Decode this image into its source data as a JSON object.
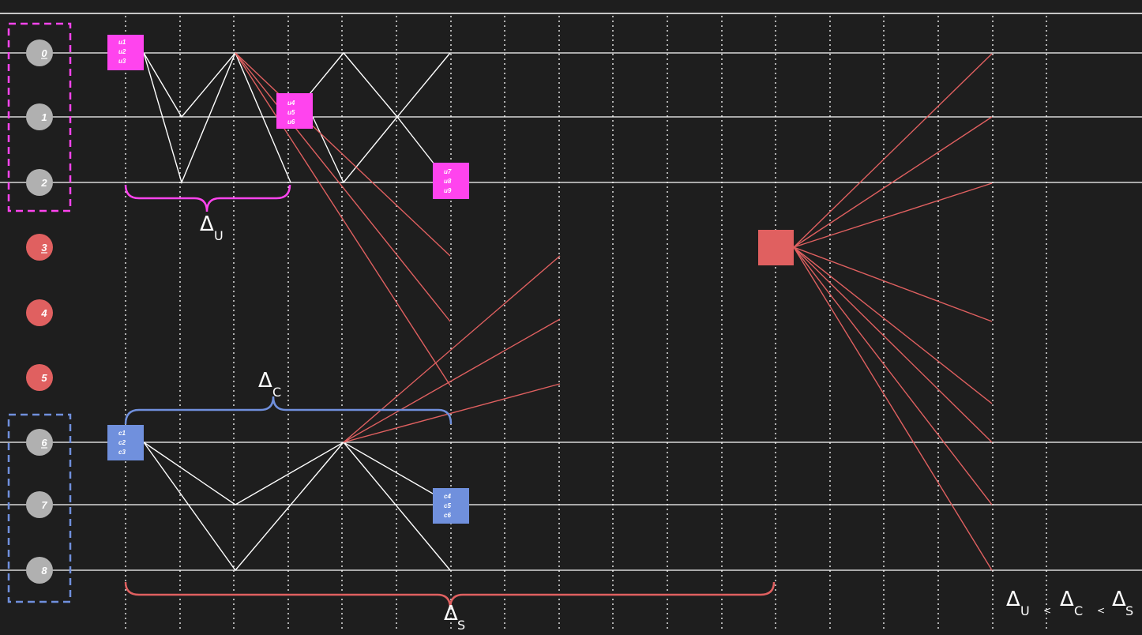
{
  "colors": {
    "background": "#1e1e1e",
    "lane_line": "#ffffff",
    "node_gray": "#b0b0b0",
    "node_red": "#e06060",
    "magenta": "#ff44ee",
    "blue": "#7090dd",
    "red": "#e06060"
  },
  "nodes": [
    {
      "label": "0",
      "underlined": true,
      "color": "gray"
    },
    {
      "label": "1",
      "underlined": false,
      "color": "gray"
    },
    {
      "label": "2",
      "underlined": false,
      "color": "gray"
    },
    {
      "label": "3",
      "underlined": true,
      "color": "red"
    },
    {
      "label": "4",
      "underlined": false,
      "color": "red"
    },
    {
      "label": "5",
      "underlined": false,
      "color": "red"
    },
    {
      "label": "6",
      "underlined": true,
      "color": "gray"
    },
    {
      "label": "7",
      "underlined": false,
      "color": "gray"
    },
    {
      "label": "8",
      "underlined": false,
      "color": "gray"
    }
  ],
  "boxes": {
    "u1": [
      "u1",
      "u2",
      "u3"
    ],
    "u2": [
      "u4",
      "u5",
      "u6"
    ],
    "u3": [
      "u7",
      "u8",
      "u9"
    ],
    "c1": [
      "c1",
      "c2",
      "c3"
    ],
    "c2": [
      "c4",
      "c5",
      "c6"
    ]
  },
  "braces": {
    "u": {
      "symbol": "Δ",
      "sub": "U"
    },
    "c": {
      "symbol": "Δ",
      "sub": "C"
    },
    "s": {
      "symbol": "Δ",
      "sub": "S"
    }
  },
  "relation": {
    "items": [
      {
        "symbol": "Δ",
        "sub": "U"
      },
      {
        "symbol": "Δ",
        "sub": "C"
      },
      {
        "symbol": "Δ",
        "sub": "S"
      }
    ],
    "separator": "<"
  }
}
